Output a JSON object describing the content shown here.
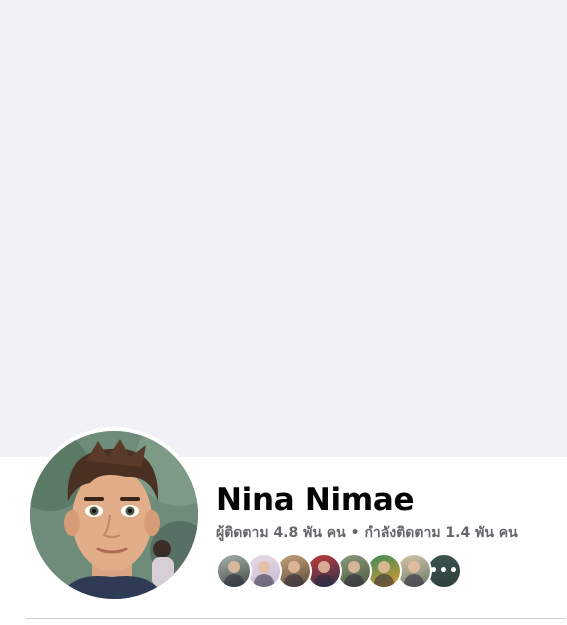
{
  "profile": {
    "name": "Nina Nimae",
    "followers_text": "ผู้ติดตาม 4.8 พัน คน",
    "separator": " • ",
    "following_text": "กำลังติดตาม 1.4 พัน คน"
  },
  "mutual_friends": [
    {
      "name": "friend-avatar-1",
      "colors": [
        "#3f4a44",
        "#a9b3ad"
      ]
    },
    {
      "name": "friend-avatar-2",
      "colors": [
        "#c8b9d2",
        "#e8dce8"
      ]
    },
    {
      "name": "friend-avatar-3",
      "colors": [
        "#5a4a3a",
        "#c9a57a"
      ]
    },
    {
      "name": "friend-avatar-4",
      "colors": [
        "#2b3550",
        "#c43a3a"
      ]
    },
    {
      "name": "friend-avatar-5",
      "colors": [
        "#4c5a40",
        "#8e9a7c"
      ]
    },
    {
      "name": "friend-avatar-6",
      "colors": [
        "#e09a30",
        "#3a8a5a"
      ]
    },
    {
      "name": "friend-avatar-7",
      "colors": [
        "#6a7a6a",
        "#d8c8a8"
      ]
    },
    {
      "name": "more-friends",
      "colors": [
        "#2c3e3a",
        "#3d5550"
      ],
      "more": "•••"
    }
  ],
  "colors": {
    "cover": "#f0f2f5",
    "name": "#050505",
    "secondary": "#65676b",
    "divider": "#ced0d4"
  }
}
